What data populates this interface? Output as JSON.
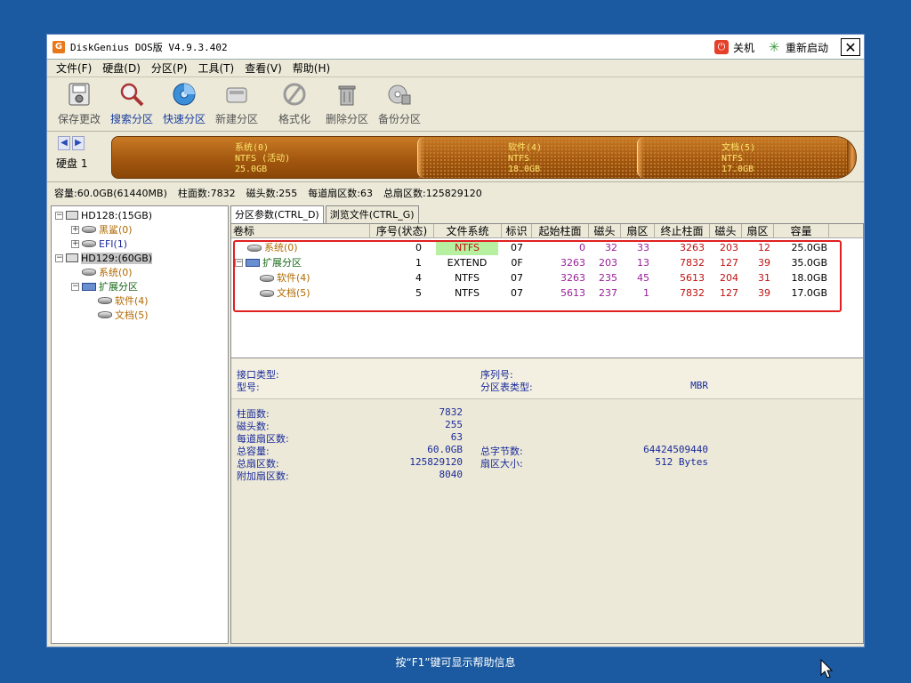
{
  "window": {
    "title": "DiskGenius DOS版 V4.9.3.402",
    "shutdown_label": "关机",
    "restart_label": "重新启动",
    "close_label": "✕"
  },
  "menu": [
    "文件(F)",
    "硬盘(D)",
    "分区(P)",
    "工具(T)",
    "查看(V)",
    "帮助(H)"
  ],
  "toolbar": [
    {
      "label": "保存更改",
      "icon": "save-icon",
      "active": false
    },
    {
      "label": "搜索分区",
      "icon": "search-partition-icon",
      "active": true
    },
    {
      "label": "快速分区",
      "icon": "quick-partition-icon",
      "active": true
    },
    {
      "label": "新建分区",
      "icon": "new-partition-icon",
      "active": false
    },
    {
      "label": "格式化",
      "icon": "format-icon",
      "active": false
    },
    {
      "label": "删除分区",
      "icon": "delete-partition-icon",
      "active": false
    },
    {
      "label": "备份分区",
      "icon": "backup-partition-icon",
      "active": false
    }
  ],
  "diskbar": {
    "disk_label": "硬盘 1",
    "partitions": [
      {
        "name": "系统(0)",
        "fs": "NTFS (活动)",
        "size": "25.0GB"
      },
      {
        "name": "软件(4)",
        "fs": "NTFS",
        "size": "18.0GB"
      },
      {
        "name": "文档(5)",
        "fs": "NTFS",
        "size": "17.0GB"
      }
    ]
  },
  "disk_info": {
    "capacity": "容量:60.0GB(61440MB)",
    "cylinders": "柱面数:7832",
    "heads": "磁头数:255",
    "sectors_per_track": "每道扇区数:63",
    "total_sectors": "总扇区数:125829120"
  },
  "tree": {
    "hd128": "HD128:(15GB)",
    "hd128_children": [
      "黑鲨(0)",
      "EFI(1)"
    ],
    "hd129": "HD129:(60GB)",
    "hd129_sys": "系统(0)",
    "hd129_ext": "扩展分区",
    "hd129_ext_children": [
      "软件(4)",
      "文档(5)"
    ]
  },
  "tabs": [
    "分区参数(CTRL_D)",
    "浏览文件(CTRL_G)"
  ],
  "table": {
    "headers": [
      "卷标",
      "序号(状态)",
      "文件系统",
      "标识",
      "起始柱面",
      "磁头",
      "扇区",
      "终止柱面",
      "磁头",
      "扇区",
      "容量"
    ],
    "rows": [
      {
        "label": "系统(0)",
        "seq": "0",
        "fs": "NTFS",
        "id": "07",
        "start_cyl": "0",
        "start_head": "32",
        "start_sec": "33",
        "end_cyl": "3263",
        "end_head": "203",
        "end_sec": "12",
        "size": "25.0GB"
      },
      {
        "label": "扩展分区",
        "seq": "1",
        "fs": "EXTEND",
        "id": "0F",
        "start_cyl": "3263",
        "start_head": "203",
        "start_sec": "13",
        "end_cyl": "7832",
        "end_head": "127",
        "end_sec": "39",
        "size": "35.0GB"
      },
      {
        "label": "软件(4)",
        "seq": "4",
        "fs": "NTFS",
        "id": "07",
        "start_cyl": "3263",
        "start_head": "235",
        "start_sec": "45",
        "end_cyl": "5613",
        "end_head": "204",
        "end_sec": "31",
        "size": "18.0GB"
      },
      {
        "label": "文档(5)",
        "seq": "5",
        "fs": "NTFS",
        "id": "07",
        "start_cyl": "5613",
        "start_head": "237",
        "start_sec": "1",
        "end_cyl": "7832",
        "end_head": "127",
        "end_sec": "39",
        "size": "17.0GB"
      }
    ]
  },
  "details": {
    "interface_label": "接口类型:",
    "model_label": "型号:",
    "serial_label": "序列号:",
    "ptable_label": "分区表类型:",
    "ptable_value": "MBR",
    "cyl_label": "柱面数:",
    "cyl_value": "7832",
    "heads_label": "磁头数:",
    "heads_value": "255",
    "spt_label": "每道扇区数:",
    "spt_value": "63",
    "cap_label": "总容量:",
    "cap_value": "60.0GB",
    "bytes_label": "总字节数:",
    "bytes_value": "64424509440",
    "tsec_label": "总扇区数:",
    "tsec_value": "125829120",
    "secsize_label": "扇区大小:",
    "secsize_value": "512 Bytes",
    "extra_label": "附加扇区数:",
    "extra_value": "8040"
  },
  "status_hint": "按“F1”键可显示帮助信息",
  "colors": {
    "desktop": "#1b5aa0",
    "partition_bar": "#b36313",
    "partition_text": "#ffe66b",
    "highlight_box": "#e02020",
    "active_fs": "#b6f0a0"
  }
}
